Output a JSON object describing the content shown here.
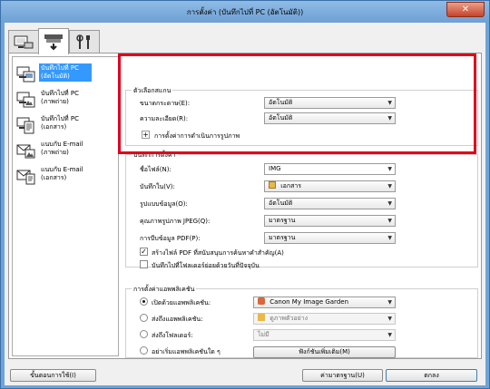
{
  "window": {
    "title": "การตั้งค่า (บันทึกไปที่ PC (อัตโนมัติ))",
    "close_glyph": "✕"
  },
  "tabs": [
    {
      "icon": "scan-from-computer-icon",
      "active": false
    },
    {
      "icon": "scan-from-panel-icon",
      "active": true
    },
    {
      "icon": "general-settings-icon",
      "active": false
    }
  ],
  "left_list": [
    {
      "label": "บันทึกไปที่ PC (อัตโนมัติ)",
      "icon": "auto-scan-icon",
      "selected": true
    },
    {
      "label": "บันทึกไปที่ PC (ภาพถ่าย)",
      "icon": "photo-scan-icon",
      "selected": false
    },
    {
      "label": "บันทึกไปที่ PC (เอกสาร)",
      "icon": "document-scan-icon",
      "selected": false
    },
    {
      "label": "แนบกับ E-mail (ภาพถ่าย)",
      "icon": "email-photo-icon",
      "selected": false
    },
    {
      "label": "แนบกับ E-mail (เอกสาร)",
      "icon": "email-document-icon",
      "selected": false
    }
  ],
  "scan_options": {
    "group_label": "ตัวเลือกสแกน",
    "paper_size_label": "ขนาดกระดาษ(E):",
    "paper_size_value": "อัตโนมัติ",
    "resolution_label": "ความละเอียด(R):",
    "resolution_value": "อัตโนมัติ",
    "image_processing_label": "การตั้งค่าการดำเนินการรูปภาพ"
  },
  "save_settings": {
    "group_label": "บันทึกการตั้งค่า",
    "file_name_label": "ชื่อไฟล์(N):",
    "file_name_value": "IMG",
    "save_in_label": "บันทึกใน(V):",
    "save_in_value": "เอกสาร",
    "data_format_label": "รูปแบบข้อมูล(O):",
    "data_format_value": "อัตโนมัติ",
    "jpeg_quality_label": "คุณภาพรูปภาพ JPEG(Q):",
    "jpeg_quality_value": "มาตรฐาน",
    "pdf_compression_label": "การบีบข้อมูล PDF(P):",
    "pdf_compression_value": "มาตรฐาน",
    "keyword_pdf_label": "สร้างไฟล์ PDF ที่สนับสนุนการค้นหาคำสำคัญ(A)",
    "keyword_pdf_checked": true,
    "subfolder_label": "บันทึกไปที่โฟลเดอร์ย่อยด้วยวันที่ปัจจุบัน",
    "subfolder_checked": false
  },
  "app_settings": {
    "group_label": "การตั้งค่าแอพพลิเคชัน",
    "open_app_label": "เปิดด้วยแอพพลิเคชัน:",
    "open_app_value": "Canon My Image Garden",
    "send_app_label": "ส่งถึงแอพพลิเคชัน:",
    "send_app_value": "ดูภาพตัวอย่าง",
    "send_folder_label": "ส่งถึงโฟลเดอร์:",
    "send_folder_value": "ไม่มี",
    "no_app_label": "อย่าเริ่มแอพพลิเคชันใด ๆ",
    "more_functions_label": "ฟังก์ชันเพิ่มเติม(M)",
    "selected_option": "open_app"
  },
  "footer": {
    "instructions_label": "ขั้นตอนการใช้(I)",
    "defaults_label": "ค่ามาตรฐาน(U)",
    "ok_label": "ตกลง"
  }
}
